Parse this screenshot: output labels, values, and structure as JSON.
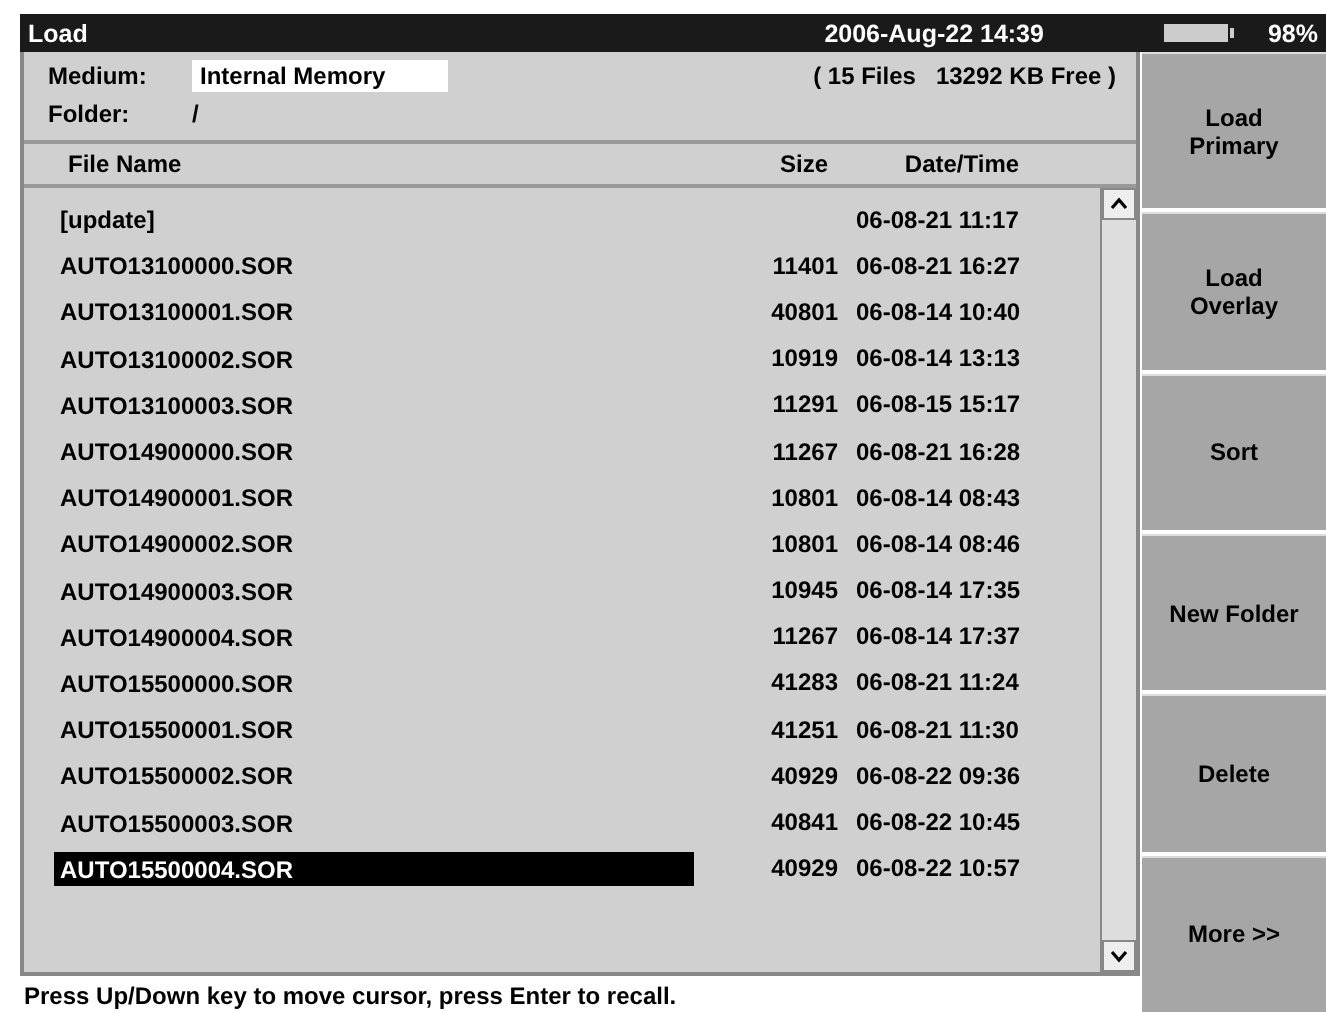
{
  "title_bar": {
    "title": "Load",
    "datetime": "2006-Aug-22 14:39",
    "battery": {
      "level": 0.98
    },
    "battery_text": "98%"
  },
  "info": {
    "medium_label": "Medium:",
    "medium": "Internal Memory",
    "summary": "( 15 Files   13292 KB Free )",
    "folder_label": "Folder:",
    "folder": "/"
  },
  "table": {
    "columns": [
      "File Name",
      "Size",
      "Date/Time"
    ],
    "rows": [
      {
        "name": "[update]",
        "size": "",
        "date": "06-08-21 11:17",
        "selected": false
      },
      {
        "name": "AUTO13100000.SOR",
        "size": "11401",
        "date": "06-08-21 16:27",
        "selected": false
      },
      {
        "name": "AUTO13100001.SOR",
        "size": "40801",
        "date": "06-08-14 10:40",
        "selected": false
      },
      {
        "name": "AUTO13100002.SOR",
        "size": "10919",
        "date": "06-08-14 13:13",
        "selected": false
      },
      {
        "name": "AUTO13100003.SOR",
        "size": "11291",
        "date": "06-08-15 15:17",
        "selected": false
      },
      {
        "name": "AUTO14900000.SOR",
        "size": "11267",
        "date": "06-08-21 16:28",
        "selected": false
      },
      {
        "name": "AUTO14900001.SOR",
        "size": "10801",
        "date": "06-08-14 08:43",
        "selected": false
      },
      {
        "name": "AUTO14900002.SOR",
        "size": "10801",
        "date": "06-08-14 08:46",
        "selected": false
      },
      {
        "name": "AUTO14900003.SOR",
        "size": "10945",
        "date": "06-08-14 17:35",
        "selected": false
      },
      {
        "name": "AUTO14900004.SOR",
        "size": "11267",
        "date": "06-08-14 17:37",
        "selected": false
      },
      {
        "name": "AUTO15500000.SOR",
        "size": "41283",
        "date": "06-08-21 11:24",
        "selected": false
      },
      {
        "name": "AUTO15500001.SOR",
        "size": "41251",
        "date": "06-08-21 11:30",
        "selected": false
      },
      {
        "name": "AUTO15500002.SOR",
        "size": "40929",
        "date": "06-08-22 09:36",
        "selected": false
      },
      {
        "name": "AUTO15500003.SOR",
        "size": "40841",
        "date": "06-08-22 10:45",
        "selected": false
      },
      {
        "name": "AUTO15500004.SOR",
        "size": "40929",
        "date": "06-08-22 10:57",
        "selected": true
      }
    ]
  },
  "status_bar": "Press Up/Down key to move cursor, press Enter to recall.",
  "softkeys": [
    "Load\nPrimary",
    "Load\nOverlay",
    "Sort",
    "New Folder",
    "Delete",
    "More >>"
  ]
}
